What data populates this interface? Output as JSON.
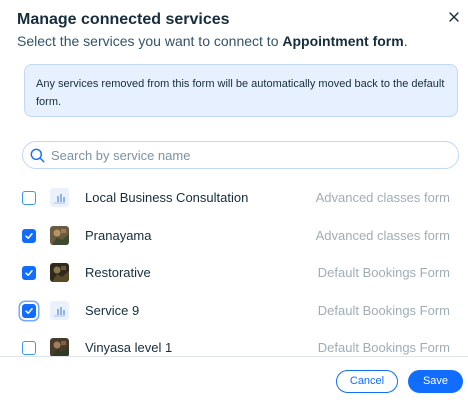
{
  "dialog": {
    "title": "Manage connected services",
    "subtitle_prefix": "Select the services you want to connect to ",
    "subtitle_form": "Appointment form",
    "subtitle_suffix": ".",
    "close_icon": "close-icon"
  },
  "notice": {
    "text": "Any services removed from this form will be automatically moved back to the default form."
  },
  "search": {
    "placeholder": "Search by service name",
    "value": "",
    "icon": "search-icon"
  },
  "services": [
    {
      "name": "Local Business Consultation",
      "form": "Advanced classes form",
      "checked": false,
      "thumb": "placeholder-image"
    },
    {
      "name": "Pranayama",
      "form": "Advanced classes form",
      "checked": true,
      "thumb": "photo"
    },
    {
      "name": "Restorative",
      "form": "Default Bookings Form",
      "checked": true,
      "thumb": "photo"
    },
    {
      "name": "Service 9",
      "form": "Default Bookings Form",
      "checked": true,
      "thumb": "placeholder-image"
    },
    {
      "name": "Vinyasa level 1",
      "form": "Default Bookings Form",
      "checked": false,
      "thumb": "photo"
    }
  ],
  "footer": {
    "cancel_label": "Cancel",
    "save_label": "Save"
  },
  "colors": {
    "accent": "#116dff",
    "notice_bg": "#e7f0ff",
    "text_primary": "#162d3d",
    "text_secondary": "#a0adb7"
  }
}
